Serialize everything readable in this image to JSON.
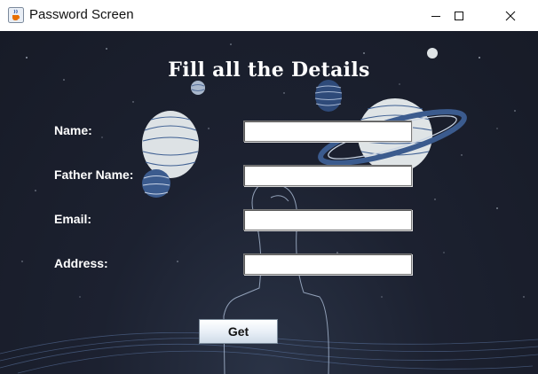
{
  "window": {
    "title": "Password Screen",
    "app_icon": "java-cup-icon",
    "controls": [
      "minimize-icon",
      "maximize-icon",
      "close-icon"
    ]
  },
  "form": {
    "heading": "Fill all the Details",
    "fields": [
      {
        "label": "Name:",
        "value": ""
      },
      {
        "label": "Father Name:",
        "value": ""
      },
      {
        "label": "Email:",
        "value": ""
      },
      {
        "label": "Address:",
        "value": ""
      }
    ],
    "submit_label": "Get"
  },
  "colors": {
    "background": "#1c2130",
    "text": "#ffffff",
    "planet": "#dfe4e6",
    "planet_lines": "#2f4a78"
  }
}
